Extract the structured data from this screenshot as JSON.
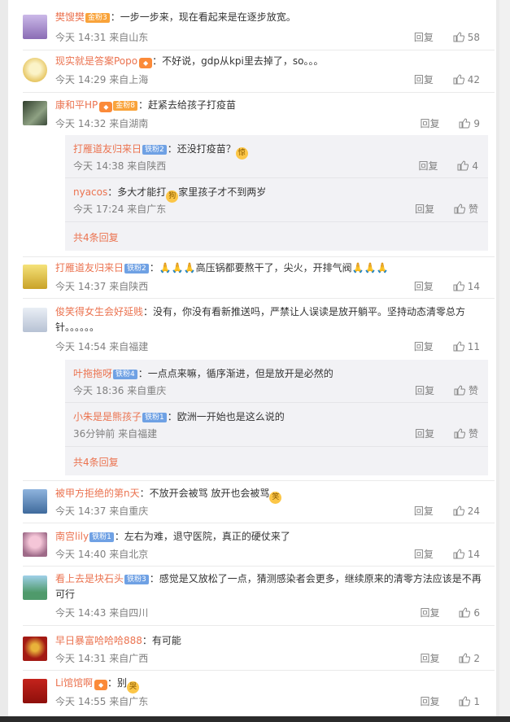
{
  "ui": {
    "reply_label": "回复",
    "like_label_fallback": "赞",
    "more_replies": "共4条回复"
  },
  "comments": [
    {
      "user": "樊馊樊",
      "badge": "金粉3",
      "badge_type": "gold",
      "vip": false,
      "text": "：一步一步来，现在看起来是在逐步放宽。",
      "time": "今天 14:31 来自山东",
      "likes": "58"
    },
    {
      "user": "现实就是答案Popo",
      "badge": "",
      "vip": true,
      "text": "：不好说，gdp从kpi里去掉了，so。。。",
      "time": "今天 14:29 来自上海",
      "likes": "42"
    },
    {
      "user": "康和平HP",
      "badge": "金粉8",
      "badge_type": "gold",
      "vip": true,
      "text": "：赶紧去给孩子打疫苗",
      "time": "今天 14:32 来自湖南",
      "likes": "9",
      "replies": [
        {
          "user": "打雁道友归来日",
          "badge": "铁粉2",
          "text": "：还没打疫苗？",
          "emoji": "惊",
          "time": "今天 14:38 来自陕西",
          "likes": "4"
        },
        {
          "user": "nyacos",
          "badge": "",
          "text": "：多大才能打",
          "emoji": "狗",
          "text2": "家里孩子才不到两岁",
          "time": "今天 17:24 来自广东",
          "likes": "赞"
        }
      ]
    },
    {
      "user": "打雁道友归来日",
      "badge": "铁粉2",
      "badge_type": "blue",
      "vip": false,
      "text": "：🙏🙏🙏高压锅都要熬干了，尖火，开排气阀🙏🙏🙏",
      "time": "今天 14:37 来自陕西",
      "likes": "14"
    },
    {
      "user": "俊笑得女生会好延贱",
      "badge": "",
      "vip": false,
      "text": "：没有，你没有看新推送吗，严禁让人误读是放开躺平。坚持动态清零总方针。。。。。。",
      "time": "今天 14:54 来自福建",
      "likes": "11",
      "replies": [
        {
          "user": "叶拖拖呀",
          "badge": "铁粉4",
          "text": "：一点点来嘛，循序渐进，但是放开是必然的",
          "time": "今天 18:36 来自重庆",
          "likes": "赞"
        },
        {
          "user": "小朱是是熊孩子",
          "badge": "铁粉1",
          "text": "：欧洲一开始也是这么说的",
          "time": "36分钟前 来自福建",
          "likes": "赞"
        }
      ]
    },
    {
      "user": "被甲方拒绝的第n天",
      "badge": "",
      "vip": false,
      "text": "：不放开会被骂 放开也会被骂",
      "emoji": "笑",
      "time": "今天 14:37 来自重庆",
      "likes": "24"
    },
    {
      "user": "南宫lily",
      "badge": "铁粉1",
      "badge_type": "blue",
      "vip": false,
      "text": "：左右为难，退守医院，真正的硬仗来了",
      "time": "今天 14:40 来自北京",
      "likes": "14"
    },
    {
      "user": "看上去是块石头",
      "badge": "铁粉3",
      "badge_type": "blue",
      "vip": false,
      "text": "：感觉是又放松了一点，猜测感染者会更多，继续原来的清零方法应该是不再可行",
      "time": "今天 14:43 来自四川",
      "likes": "6"
    },
    {
      "user": "早日暴富哈哈哈888",
      "badge": "",
      "vip": false,
      "text": "：有可能",
      "time": "今天 14:31 来自广西",
      "likes": "2"
    },
    {
      "user": "Li馆馆啊",
      "badge": "",
      "vip": true,
      "text": "：别",
      "emoji": "哭",
      "time": "今天 14:55 来自广东",
      "likes": "1"
    }
  ]
}
